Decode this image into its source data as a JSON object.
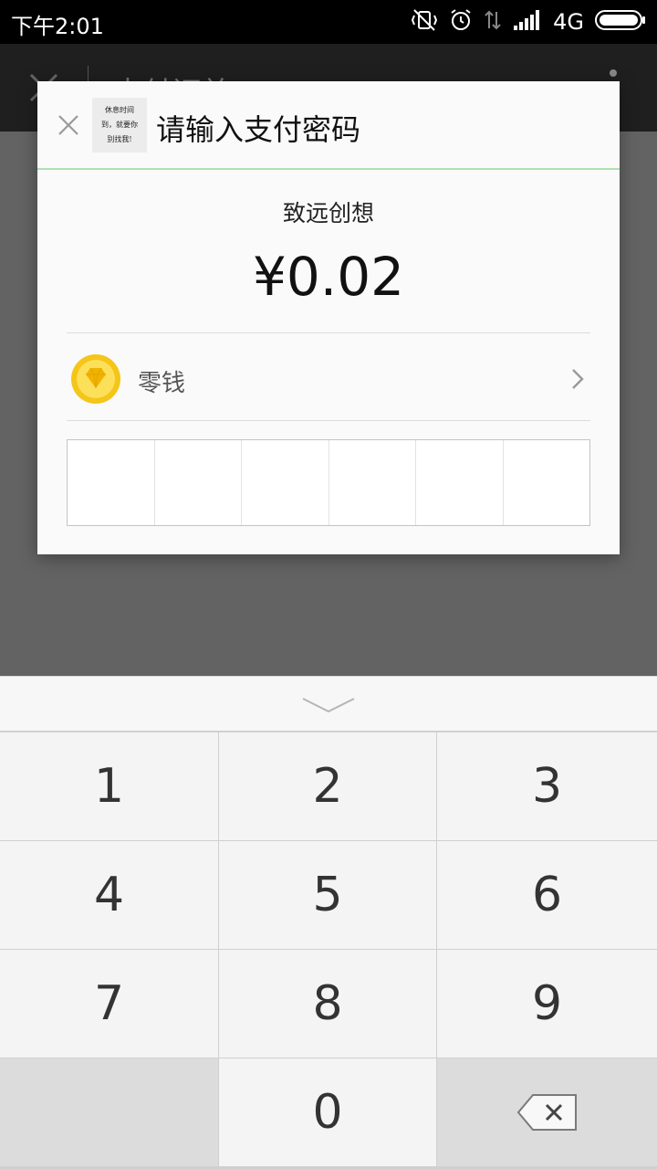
{
  "status_bar": {
    "time": "下午2:01",
    "network": "4G",
    "icons": [
      "vibrate-off-icon",
      "alarm-icon",
      "data-transfer-icon",
      "signal-icon",
      "battery-icon"
    ]
  },
  "app_bar": {
    "title": "支付订单"
  },
  "dialog": {
    "title": "请输入支付密码",
    "merchant_thumb_lines": [
      "休息时间",
      "到，就要你",
      "别找我!"
    ],
    "merchant_name": "致远创想",
    "amount": "¥0.02",
    "pay_method": {
      "label": "零钱",
      "icon": "diamond-coin-icon"
    },
    "pin_length": 6,
    "divider_color": "#b3dfb3"
  },
  "keypad": {
    "keys": [
      "1",
      "2",
      "3",
      "4",
      "5",
      "6",
      "7",
      "8",
      "9",
      "",
      "0",
      "backspace"
    ]
  },
  "colors": {
    "overlay": "#636363",
    "coin": "#f5c518"
  }
}
